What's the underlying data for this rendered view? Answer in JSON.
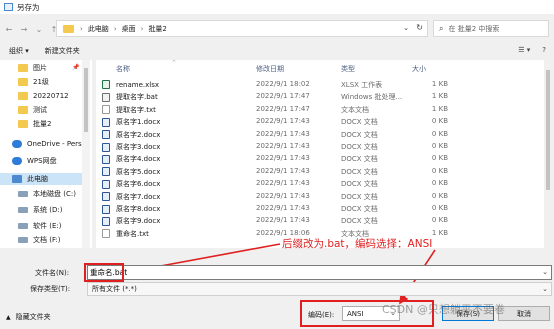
{
  "window": {
    "title": "另存为"
  },
  "nav": {
    "back": "←",
    "forward": "→",
    "up_dropdown": "⌄",
    "up": "↑",
    "breadcrumb": [
      "此电脑",
      "桌面",
      "批量2"
    ],
    "search_placeholder": "在 批量2 中搜索"
  },
  "toolbar": {
    "organize": "组织 ▾",
    "new_folder": "新建文件夹",
    "view": "☰ ▾",
    "help": "?"
  },
  "sidebar": {
    "items": [
      {
        "label": "图片",
        "type": "folder",
        "pinned": true
      },
      {
        "label": "21级",
        "type": "folder"
      },
      {
        "label": "20220712",
        "type": "folder"
      },
      {
        "label": "测试",
        "type": "folder"
      },
      {
        "label": "批量2",
        "type": "folder"
      },
      {
        "label": "OneDrive - Perso",
        "type": "cloud"
      },
      {
        "label": "WPS网盘",
        "type": "cloud"
      },
      {
        "label": "此电脑",
        "type": "pc",
        "selected": true
      },
      {
        "label": "本地磁盘 (C:)",
        "type": "drive"
      },
      {
        "label": "系统 (D:)",
        "type": "drive"
      },
      {
        "label": "软件 (E:)",
        "type": "drive"
      },
      {
        "label": "文档 (F:)",
        "type": "drive"
      }
    ]
  },
  "columns": {
    "name": "名称",
    "modified": "修改日期",
    "type": "类型",
    "size": "大小"
  },
  "files": [
    {
      "name": "rename.xlsx",
      "modified": "2022/9/1 18:02",
      "type": "XLSX 工作表",
      "size": "1 KB",
      "icon": "xlsx"
    },
    {
      "name": "提取名字.bat",
      "modified": "2022/9/1 17:47",
      "type": "Windows 批处理...",
      "size": "1 KB",
      "icon": "bat"
    },
    {
      "name": "提取名字.txt",
      "modified": "2022/9/1 17:47",
      "type": "文本文档",
      "size": "1 KB",
      "icon": "txt"
    },
    {
      "name": "原名字1.docx",
      "modified": "2022/9/1 17:43",
      "type": "DOCX 文档",
      "size": "0 KB",
      "icon": "docx"
    },
    {
      "name": "原名字2.docx",
      "modified": "2022/9/1 17:43",
      "type": "DOCX 文档",
      "size": "0 KB",
      "icon": "docx"
    },
    {
      "name": "原名字3.docx",
      "modified": "2022/9/1 17:43",
      "type": "DOCX 文档",
      "size": "0 KB",
      "icon": "docx"
    },
    {
      "name": "原名字4.docx",
      "modified": "2022/9/1 17:43",
      "type": "DOCX 文档",
      "size": "0 KB",
      "icon": "docx"
    },
    {
      "name": "原名字5.docx",
      "modified": "2022/9/1 17:43",
      "type": "DOCX 文档",
      "size": "0 KB",
      "icon": "docx"
    },
    {
      "name": "原名字6.docx",
      "modified": "2022/9/1 17:43",
      "type": "DOCX 文档",
      "size": "0 KB",
      "icon": "docx"
    },
    {
      "name": "原名字7.docx",
      "modified": "2022/9/1 17:43",
      "type": "DOCX 文档",
      "size": "0 KB",
      "icon": "docx"
    },
    {
      "name": "原名字8.docx",
      "modified": "2022/9/1 17:43",
      "type": "DOCX 文档",
      "size": "0 KB",
      "icon": "docx"
    },
    {
      "name": "原名字9.docx",
      "modified": "2022/9/1 17:43",
      "type": "DOCX 文档",
      "size": "0 KB",
      "icon": "docx"
    },
    {
      "name": "重命名.txt",
      "modified": "2022/9/1 18:06",
      "type": "文本文档",
      "size": "1 KB",
      "icon": "txt"
    }
  ],
  "annotation": {
    "text": "后缀改为.bat，编码选择：ANSI",
    "color": "#e02020"
  },
  "form": {
    "filename_label": "文件名(N):",
    "filename_value": "重命名.bat",
    "filetype_label": "保存类型(T):",
    "filetype_value": "所有文件 (*.*)",
    "encoding_label": "编码(E):",
    "encoding_value": "ANSI"
  },
  "footer": {
    "hide_folders": "隐藏文件夹",
    "save": "保存(S)",
    "cancel": "取消"
  },
  "watermark": "CSDN @只想躺平不要卷"
}
